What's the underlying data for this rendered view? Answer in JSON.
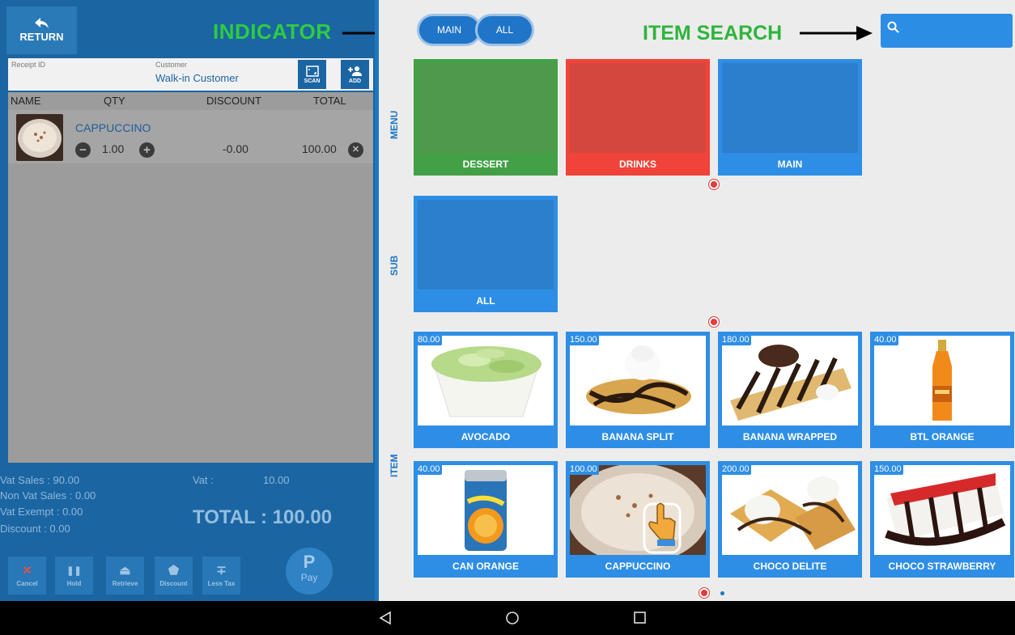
{
  "left": {
    "return_label": "RETURN",
    "indicator_label": "INDICATOR",
    "receipt_label": "Receipt ID",
    "customer_label": "Customer",
    "customer_value": "Walk-in Customer",
    "scan_label": "SCAN",
    "add_label": "ADD",
    "columns": [
      "NAME",
      "QTY",
      "DISCOUNT",
      "TOTAL"
    ],
    "order_items": [
      {
        "name": "CAPPUCCINO",
        "qty": "1.00",
        "discount": "-0.00",
        "total": "100.00"
      }
    ],
    "summary": {
      "vat_sales": "Vat Sales :   90.00",
      "vat": "Vat :",
      "vat_value": "10.00",
      "non_vat": "Non Vat Sales : 0.00",
      "vat_exempt": "Vat Exempt :   0.00",
      "discount": "Discount :      0.00",
      "total": "TOTAL : 100.00"
    },
    "actions": [
      {
        "label": "Cancel",
        "icon": "close-icon",
        "glyph": "✕"
      },
      {
        "label": "Hold",
        "icon": "pause-icon",
        "glyph": "❚❚"
      },
      {
        "label": "Retrieve",
        "icon": "eject-icon",
        "glyph": "⏏"
      },
      {
        "label": "Discount",
        "icon": "tag-icon",
        "glyph": "⬟"
      },
      {
        "label": "Less Tax",
        "icon": "divide-icon",
        "glyph": "∓"
      }
    ],
    "pay_glyph": "P",
    "pay_label": "Pay"
  },
  "right": {
    "pills": [
      "MAIN",
      "ALL"
    ],
    "search_label": "ITEM SEARCH",
    "section_labels": {
      "menu": "MENU",
      "sub": "SUB",
      "item": "ITEM"
    },
    "menu_tiles": [
      {
        "name": "DESSERT",
        "color": "#4e9a4c",
        "accent": "#43a047"
      },
      {
        "name": "DRINKS",
        "color": "#d4473f",
        "accent": "#f0433a"
      },
      {
        "name": "MAIN",
        "color": "#2b7fcd",
        "accent": "#2e8ee6"
      }
    ],
    "sub_tiles": [
      {
        "name": "ALL"
      }
    ],
    "items": [
      {
        "name": "AVOCADO",
        "price": "80.00"
      },
      {
        "name": "BANANA SPLIT",
        "price": "150.00"
      },
      {
        "name": "BANANA WRAPPED",
        "price": "180.00"
      },
      {
        "name": "BTL ORANGE",
        "price": "40.00"
      },
      {
        "name": "CAN ORANGE",
        "price": "40.00"
      },
      {
        "name": "CAPPUCCINO",
        "price": "100.00"
      },
      {
        "name": "CHOCO DELITE",
        "price": "200.00"
      },
      {
        "name": "CHOCO STRAWBERRY",
        "price": "150.00"
      }
    ]
  }
}
